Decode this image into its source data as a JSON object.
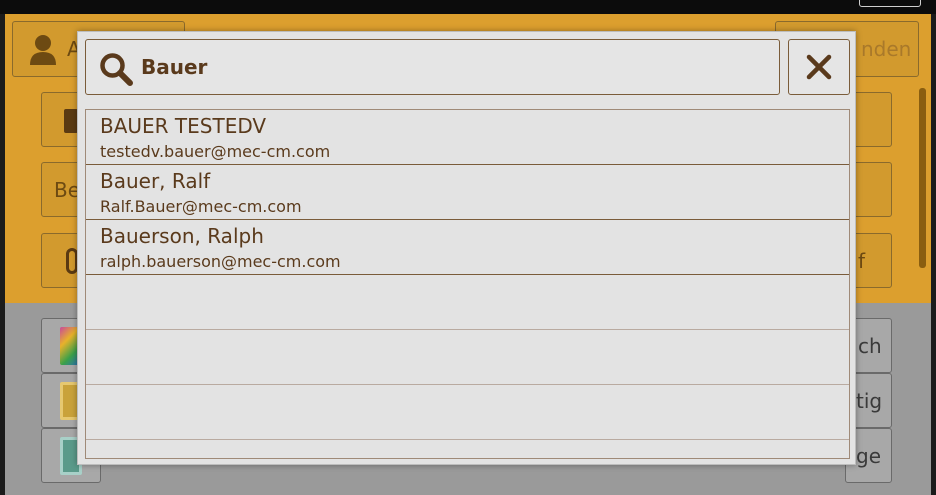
{
  "search": {
    "value": "Bauer",
    "placeholder": ""
  },
  "results": [
    {
      "name": "BAUER TESTEDV",
      "email": "testedv.bauer@mec-cm.com"
    },
    {
      "name": "Bauer, Ralf",
      "email": "Ralf.Bauer@mec-cm.com"
    },
    {
      "name": "Bauerson, Ralph",
      "email": "ralph.bauerson@mec-cm.com"
    }
  ],
  "background": {
    "top_left_fragment": "A",
    "top_right_fragment": "nden",
    "row2_left_fragment": "Be",
    "row3_right_fragment": "f",
    "list_fragments": [
      "ch",
      "tig",
      "ge"
    ]
  },
  "colors": {
    "accent": "#dc9f2e",
    "text_brown": "#5a3a1c",
    "border_brown": "#7a5c3a",
    "dialog_bg": "#e3e3e3"
  },
  "icons": {
    "search": "search-icon",
    "close": "close-icon",
    "user": "user-icon"
  }
}
